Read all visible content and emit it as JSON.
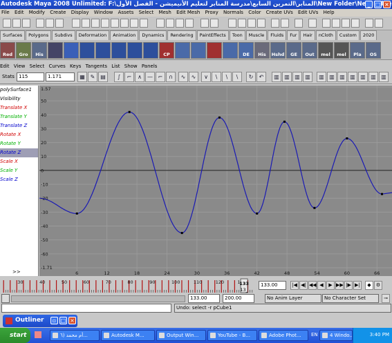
{
  "window": {
    "title": "Autodesk Maya 2008 Unlimited: F:\\المنابر\\التمرين السابع\\مدرسة المنابر لتعليم الأنيميشن - الفصل الأول\\New Folder\\New Folder\\azzzz.mb  ---  polySurf..."
  },
  "menubar": [
    "File",
    "Edit",
    "Modify",
    "Create",
    "Display",
    "Window",
    "Assets",
    "Select",
    "Mesh",
    "Edit Mesh",
    "Proxy",
    "Normals",
    "Color",
    "Create UVs",
    "Edit UVs",
    "Help"
  ],
  "shelf_tabs": [
    "Surfaces",
    "Polygons",
    "Subdivs",
    "Deformation",
    "Animation",
    "Dynamics",
    "Rendering",
    "PaintEffects",
    "Toon",
    "Muscle",
    "Fluids",
    "Fur",
    "Hair",
    "nCloth",
    "Custom",
    "2020"
  ],
  "shelf_buttons": [
    "Red",
    "Gro",
    "His",
    "CP",
    "DE",
    "His",
    "Hshd",
    "GE",
    "Out",
    "mel",
    "mel",
    "Pla",
    "OS"
  ],
  "graph_editor": {
    "menu": [
      "Edit",
      "View",
      "Select",
      "Curves",
      "Keys",
      "Tangents",
      "List",
      "Show",
      "Panels"
    ],
    "stats_label": "Stats",
    "stats_frame": "115",
    "stats_value": "1.171"
  },
  "outliner": {
    "attributes": [
      {
        "label": "polySurface1",
        "color": "#000000",
        "selected": false
      },
      {
        "label": "Visibility",
        "color": "#000000",
        "selected": false
      },
      {
        "label": "Translate X",
        "color": "#d00000",
        "selected": false
      },
      {
        "label": "Translate Y",
        "color": "#00b000",
        "selected": false
      },
      {
        "label": "Translate Z",
        "color": "#0000cc",
        "selected": false
      },
      {
        "label": "Rotate X",
        "color": "#d00000",
        "selected": false
      },
      {
        "label": "Rotate Y",
        "color": "#00b000",
        "selected": false
      },
      {
        "label": "Rotate Z",
        "color": "#0000cc",
        "selected": true
      },
      {
        "label": "Scale X",
        "color": "#d00000",
        "selected": false
      },
      {
        "label": "Scale Y",
        "color": "#00b000",
        "selected": false
      },
      {
        "label": "Scale Z",
        "color": "#0000cc",
        "selected": false
      }
    ],
    "scroll_label": ">>"
  },
  "chart_data": {
    "type": "line",
    "title": "",
    "xlabel": "",
    "ylabel": "",
    "xlim": [
      -1.5,
      69
    ],
    "ylim": [
      -71,
      57
    ],
    "x_ticks": [
      6,
      12,
      18,
      24,
      30,
      36,
      42,
      48,
      54,
      60,
      66
    ],
    "y_ticks": [
      50,
      40,
      30,
      20,
      10,
      0,
      -10,
      -20,
      -30,
      -40,
      -50,
      -60
    ],
    "y_tick_labels": [
      "1.57",
      "50",
      "40",
      "30",
      "20",
      "10",
      "0",
      "-10",
      "-20",
      "-30",
      "-40",
      "-50",
      "-60",
      "-1.71"
    ],
    "grid": true,
    "series": [
      {
        "color": "#1a1ab4",
        "keys": [
          {
            "x": 6,
            "y": -31
          },
          {
            "x": 16.5,
            "y": 42
          },
          {
            "x": 27,
            "y": -45
          },
          {
            "x": 34.5,
            "y": 38
          },
          {
            "x": 42,
            "y": -31
          },
          {
            "x": 47.5,
            "y": 35
          },
          {
            "x": 53.5,
            "y": -27
          },
          {
            "x": 60,
            "y": 23
          },
          {
            "x": 67,
            "y": -17
          }
        ]
      }
    ]
  },
  "timeslider": {
    "tick_labels": [
      "30",
      "40",
      "50",
      "60",
      "70",
      "80",
      "90",
      "100",
      "110",
      "120",
      "130"
    ],
    "current_frame": "133.00",
    "marker": "133",
    "marker_secondary": "13_"
  },
  "range": {
    "start": "133.00",
    "end": "200.00",
    "anim_layer": "No Anim Layer",
    "character_set": "No Character Set"
  },
  "command": {
    "result": "Undo: select -r pCube1"
  },
  "outliner_window": {
    "title": "Outliner"
  },
  "taskbar": {
    "start_label": "start",
    "tasks": [
      "أم محمد (٦...",
      "Autodesk M...",
      "Output Win...",
      "YouTube - B...",
      "Adobe Phot...",
      "4 Windo..."
    ],
    "lang": "EN",
    "clock": "3:40 PM"
  }
}
